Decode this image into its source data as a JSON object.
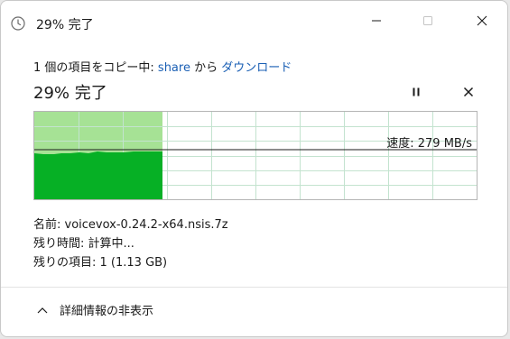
{
  "window": {
    "title": "29% 完了",
    "app_icon": "clock-icon",
    "controls": [
      "minimize-icon",
      "maximize-icon",
      "close-icon"
    ]
  },
  "copy_info": {
    "prefix": "1 個の項目をコピー中: ",
    "source": "share",
    "middle": " から ",
    "destination": "ダウンロード"
  },
  "progress": {
    "heading": "29% 完了",
    "percent": 29,
    "pause_icon": "pause-icon",
    "cancel_icon": "close-icon"
  },
  "speed": {
    "label": "速度: 279 MB/s"
  },
  "details": {
    "name_line": "名前: voicevox-0.24.2-x64.nsis.7z",
    "time_line": "残り時間: 計算中...",
    "items_line": "残りの項目: 1 (1.13 GB)"
  },
  "footer": {
    "label": "詳細情報の非表示",
    "icon": "chevron-up-icon"
  },
  "colors": {
    "progress_light": "#a6e295",
    "throughput_fill": "#06b025",
    "grid_line": "#c3e3cf",
    "link": "#1a5fb4"
  }
}
